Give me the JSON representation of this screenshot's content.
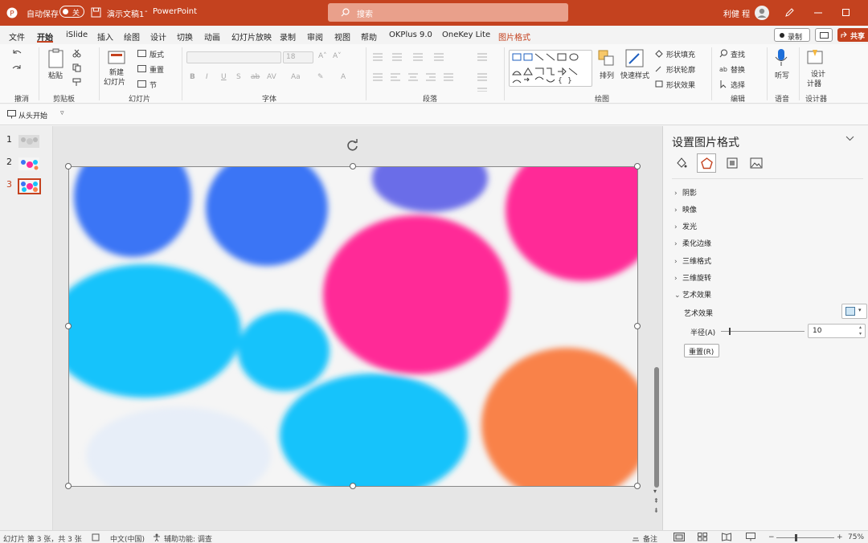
{
  "titlebar": {
    "autosave_label": "自动保存",
    "autosave_state": "关",
    "doc_title": "演示文稿1",
    "app_name": "PowerPoint",
    "search_placeholder": "搜索",
    "user_name": "利健 程"
  },
  "tabs": [
    "文件",
    "开始",
    "iSlide",
    "插入",
    "绘图",
    "设计",
    "切换",
    "动画",
    "幻灯片放映",
    "录制",
    "审阅",
    "视图",
    "帮助",
    "OKPlus 9.0",
    "OneKey Lite",
    "图片格式"
  ],
  "tabs_right": {
    "record": "录制",
    "share": "共享"
  },
  "ribbon": {
    "undo_group": "撤消",
    "clipboard": {
      "paste": "粘贴",
      "group": "剪贴板"
    },
    "slides": {
      "new_slide": "新建",
      "new_slide2": "幻灯片",
      "layout": "版式",
      "reset": "重置",
      "section": "节",
      "group": "幻灯片"
    },
    "font": {
      "font_size": "18",
      "group": "字体"
    },
    "paragraph": {
      "group": "段落"
    },
    "drawing": {
      "arrange": "排列",
      "quick_styles": "快速样式",
      "fill": "形状填充",
      "outline": "形状轮廓",
      "effects": "形状效果",
      "group": "绘图"
    },
    "editing": {
      "find": "查找",
      "replace": "替换",
      "select": "选择",
      "group": "编辑"
    },
    "voice": {
      "dictate": "听写",
      "group": "语音"
    },
    "designer": {
      "designer": "设计",
      "designer2": "计器",
      "group": "设计器"
    }
  },
  "qat": {
    "from_start": "从头开始"
  },
  "thumbnails": [
    {
      "num": "1"
    },
    {
      "num": "2"
    },
    {
      "num": "3"
    }
  ],
  "panel": {
    "title": "设置图片格式",
    "sections": [
      "阴影",
      "映像",
      "发光",
      "柔化边缘",
      "三维格式",
      "三维旋转",
      "艺术效果"
    ],
    "art_effect_label": "艺术效果",
    "radius_label": "半径(A)",
    "radius_value": "10",
    "reset_button": "重置(R)"
  },
  "status": {
    "slide_info": "幻灯片 第 3 张，共 3 张",
    "language": "中文(中国)",
    "accessibility": "辅助功能: 调查",
    "notes": "备注",
    "zoom": "75%"
  },
  "colors": {
    "accent": "#c4421f",
    "pink": "#ff2a97",
    "cyan": "#17c3fb",
    "blue": "#3b74f5",
    "orange": "#f9824a",
    "purple": "#6b6de8"
  }
}
